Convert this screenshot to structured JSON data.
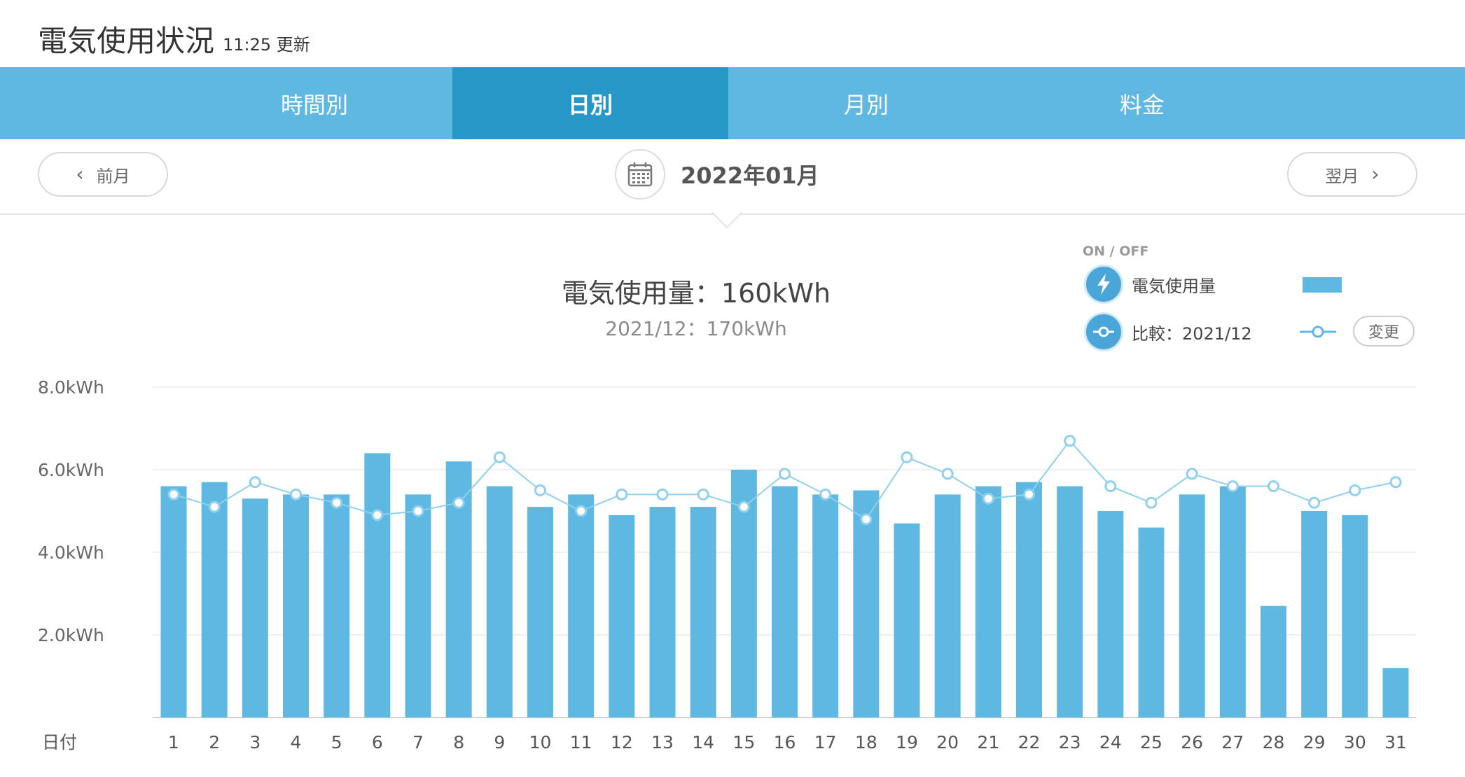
{
  "header": {
    "title": "電気使用状況",
    "updated": "11:25 更新"
  },
  "tabs": [
    {
      "label": "時間別",
      "active": false
    },
    {
      "label": "日別",
      "active": true
    },
    {
      "label": "月別",
      "active": false
    },
    {
      "label": "料金",
      "active": false
    }
  ],
  "nav": {
    "prev": "前月",
    "next": "翌月",
    "month": "2022年01月"
  },
  "summary": {
    "main": "電気使用量：160kWh",
    "compare": "2021/12：170kWh"
  },
  "legend": {
    "onoff": "ON / OFF",
    "usage": "電気使用量",
    "compare": "比較：2021/12",
    "change": "変更"
  },
  "colors": {
    "bar": "#5eb8e1",
    "line": "#5eb8e1",
    "tab_bg": "#5eb8e1",
    "tab_active": "#2797c8"
  },
  "chart_data": {
    "type": "bar",
    "xlabel": "日付",
    "y_ticks": [
      "8.0kWh",
      "6.0kWh",
      "4.0kWh",
      "2.0kWh"
    ],
    "ylim": [
      0,
      8
    ],
    "categories": [
      "1",
      "2",
      "3",
      "4",
      "5",
      "6",
      "7",
      "8",
      "9",
      "10",
      "11",
      "12",
      "13",
      "14",
      "15",
      "16",
      "17",
      "18",
      "19",
      "20",
      "21",
      "22",
      "23",
      "24",
      "25",
      "26",
      "27",
      "28",
      "29",
      "30",
      "31"
    ],
    "series": [
      {
        "name": "電気使用量",
        "type": "bar",
        "values": [
          5.6,
          5.7,
          5.3,
          5.4,
          5.4,
          6.4,
          5.4,
          6.2,
          5.6,
          5.1,
          5.4,
          4.9,
          5.1,
          5.1,
          6.0,
          5.6,
          5.4,
          5.5,
          4.7,
          5.4,
          5.6,
          5.7,
          5.6,
          5.0,
          4.6,
          5.4,
          5.6,
          2.7,
          5.0,
          4.9,
          1.2
        ]
      },
      {
        "name": "比較：2021/12",
        "type": "line",
        "values": [
          5.4,
          5.1,
          5.7,
          5.4,
          5.2,
          4.9,
          5.0,
          5.2,
          6.3,
          5.5,
          5.0,
          5.4,
          5.4,
          5.4,
          5.1,
          5.9,
          5.4,
          4.8,
          6.3,
          5.9,
          5.3,
          5.4,
          6.7,
          5.6,
          5.2,
          5.9,
          5.6,
          5.6,
          5.2,
          5.5,
          5.7
        ]
      }
    ],
    "grid": true
  }
}
